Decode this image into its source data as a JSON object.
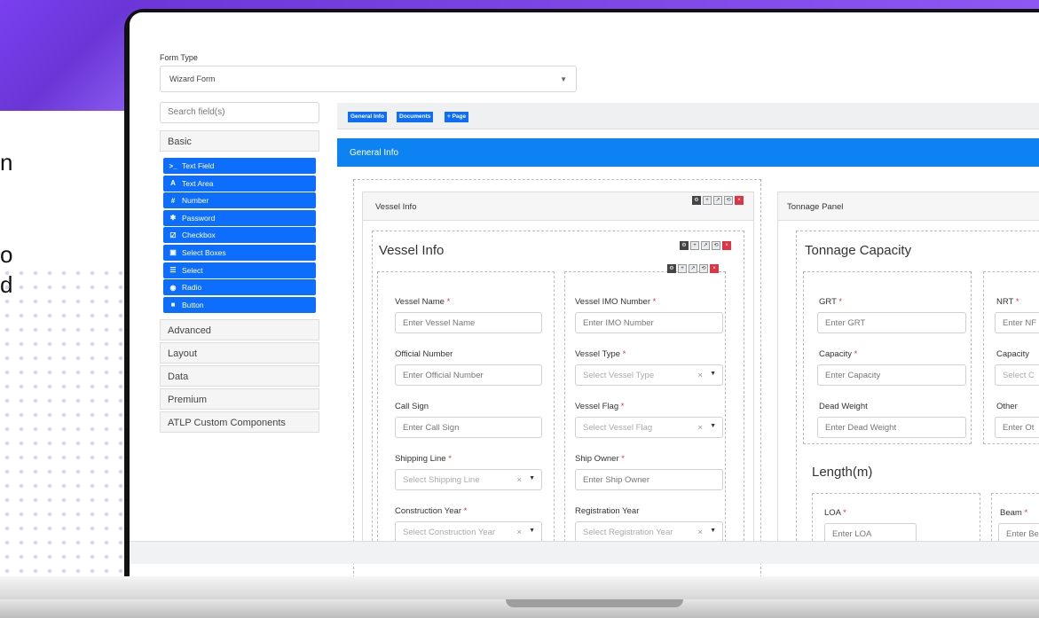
{
  "left_text": [
    "n",
    "o",
    "d"
  ],
  "form_type": {
    "label": "Form Type",
    "value": "Wizard Form"
  },
  "search": {
    "placeholder": "Search field(s)"
  },
  "categories": [
    "Basic",
    "Advanced",
    "Layout",
    "Data",
    "Premium",
    "ATLP Custom Components"
  ],
  "basic_fields": [
    {
      "icon": ">_",
      "label": "Text Field"
    },
    {
      "icon": "A",
      "label": "Text Area"
    },
    {
      "icon": "#",
      "label": "Number"
    },
    {
      "icon": "✱",
      "label": "Password"
    },
    {
      "icon": "☑",
      "label": "Checkbox"
    },
    {
      "icon": "▣",
      "label": "Select Boxes"
    },
    {
      "icon": "☰",
      "label": "Select"
    },
    {
      "icon": "◉",
      "label": "Radio"
    },
    {
      "icon": "■",
      "label": "Button"
    }
  ],
  "tabs": [
    "General Info",
    "Documents",
    "+ Page"
  ],
  "panel_title": "General Info",
  "vessel": {
    "card_title": "Vessel Info",
    "heading": "Vessel Info",
    "fields": {
      "name": {
        "label": "Vessel Name",
        "placeholder": "Enter Vessel Name"
      },
      "imo": {
        "label": "Vessel IMO Number",
        "placeholder": "Enter IMO Number"
      },
      "official": {
        "label": "Official Number",
        "placeholder": "Enter Official Number"
      },
      "type": {
        "label": "Vessel Type",
        "placeholder": "Select Vessel Type"
      },
      "call": {
        "label": "Call Sign",
        "placeholder": "Enter Call Sign"
      },
      "flag": {
        "label": "Vessel Flag",
        "placeholder": "Select Vessel Flag"
      },
      "line": {
        "label": "Shipping Line",
        "placeholder": "Select Shipping Line"
      },
      "owner": {
        "label": "Ship Owner",
        "placeholder": "Enter Ship Owner"
      },
      "construction": {
        "label": "Construction Year",
        "placeholder": "Select Construction Year"
      },
      "registration": {
        "label": "Registration Year",
        "placeholder": "Select Registration Year"
      }
    }
  },
  "tonnage": {
    "card_title": "Tonnage Panel",
    "heading": "Tonnage Capacity",
    "length_heading": "Length(m)",
    "fields": {
      "grt": {
        "label": "GRT",
        "placeholder": "Enter GRT"
      },
      "nrt": {
        "label": "NRT",
        "placeholder": "Enter NF"
      },
      "capacity": {
        "label": "Capacity",
        "placeholder": "Enter Capacity"
      },
      "capacity2": {
        "label": "Capacity",
        "placeholder": "Select C"
      },
      "dead": {
        "label": "Dead Weight",
        "placeholder": "Enter Dead Weight"
      },
      "other": {
        "label": "Other",
        "placeholder": "Enter Ot"
      },
      "loa": {
        "label": "LOA",
        "placeholder": "Enter LOA"
      },
      "beam": {
        "label": "Beam",
        "placeholder": "Enter Be"
      }
    }
  },
  "clear_symbol": "×",
  "caret_symbol": "▼",
  "required_mark": "*",
  "toolbar_icons": [
    "⚙",
    "+",
    "↗",
    "⟲",
    "×"
  ]
}
